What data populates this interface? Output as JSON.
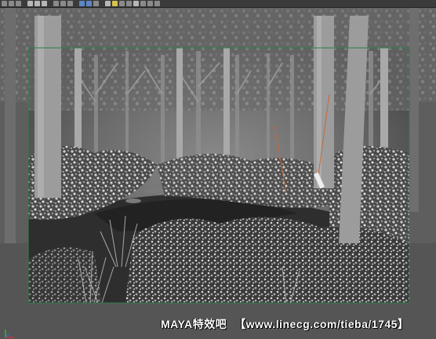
{
  "toolbar": {
    "icons": [
      "select-icon",
      "lasso-icon",
      "paint-icon",
      "move-icon",
      "rotate-icon",
      "scale-icon",
      "snap-grid-icon",
      "snap-curve-icon",
      "snap-point-icon",
      "render-icon",
      "ipr-icon",
      "render-settings-icon",
      "camera-icon",
      "light-icon",
      "texture-icon",
      "wireframe-icon",
      "shaded-icon",
      "isolate-icon",
      "xray-icon",
      "grid-icon"
    ]
  },
  "watermark": {
    "brand": "MAYA特效吧",
    "url": "【www.linecg.com/tieba/1745】"
  },
  "colors": {
    "resolution_gate": "#2e7d4a",
    "background": "#5a5a5a",
    "toolbar": "#3b3b3b"
  }
}
